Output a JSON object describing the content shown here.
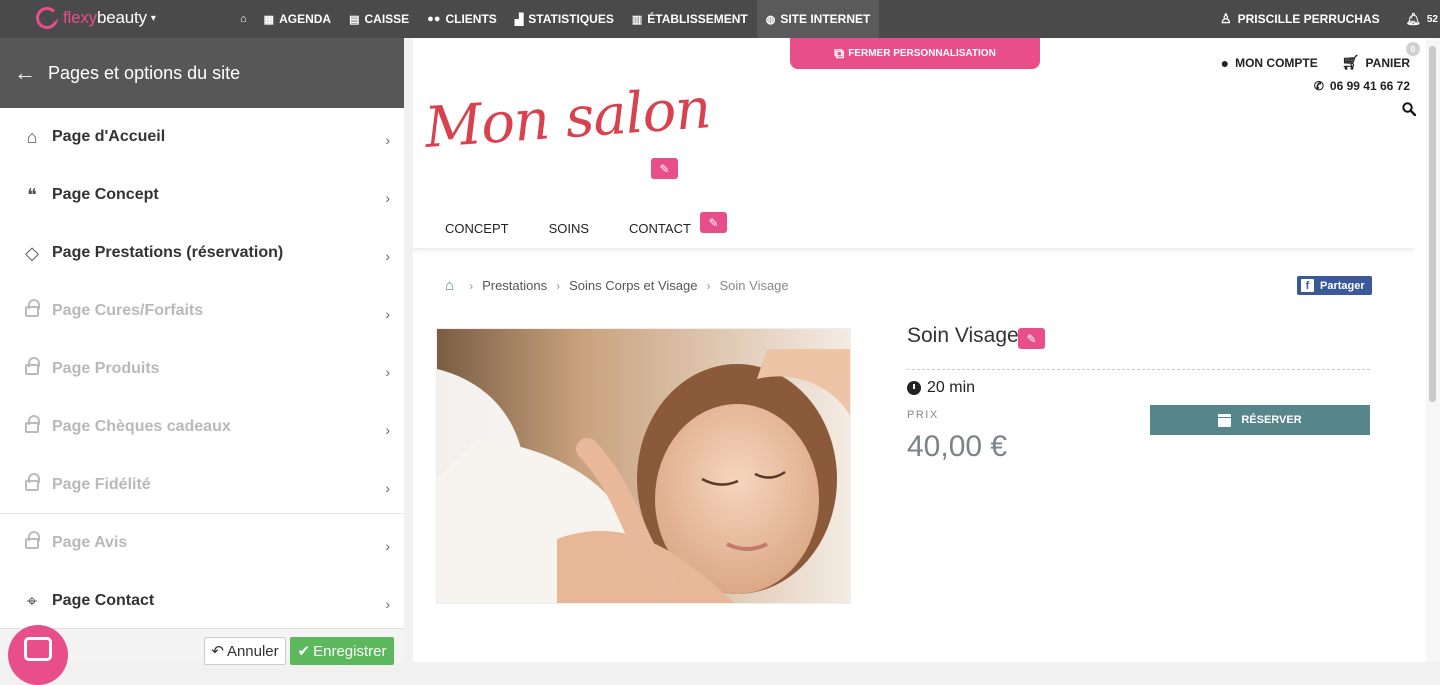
{
  "topbar": {
    "brand_flexy": "flexy",
    "brand_beauty": "beauty",
    "nav": [
      {
        "label": "",
        "icon": "home-icon"
      },
      {
        "label": "AGENDA",
        "icon": "calendar-icon"
      },
      {
        "label": "CAISSE",
        "icon": "money-icon"
      },
      {
        "label": "CLIENTS",
        "icon": "users-icon"
      },
      {
        "label": "STATISTIQUES",
        "icon": "chart-icon"
      },
      {
        "label": "ÉTABLISSEMENT",
        "icon": "store-icon"
      },
      {
        "label": "SITE INTERNET",
        "icon": "globe-icon"
      }
    ],
    "user_name": "PRISCILLE PERRUCHAS",
    "notif_count": "52"
  },
  "panel": {
    "title": "Pages et options du site",
    "items": [
      {
        "label": "Page d'Accueil",
        "icon": "home-outline-icon",
        "locked": false
      },
      {
        "label": "Page Concept",
        "icon": "quote-icon",
        "locked": false
      },
      {
        "label": "Page Prestations (réservation)",
        "icon": "tag-icon",
        "locked": false
      },
      {
        "label": "Page Cures/Forfaits",
        "icon": "lock-icon",
        "locked": true
      },
      {
        "label": "Page Produits",
        "icon": "lock-icon",
        "locked": true
      },
      {
        "label": "Page Chèques cadeaux",
        "icon": "lock-icon",
        "locked": true
      },
      {
        "label": "Page Fidélité",
        "icon": "lock-icon",
        "locked": true
      },
      {
        "label": "Page Avis",
        "icon": "lock-icon",
        "locked": true
      },
      {
        "label": "Page Contact",
        "icon": "map-pin-icon",
        "locked": false
      }
    ],
    "cancel_label": "Annuler",
    "save_label": "Enregistrer"
  },
  "preview": {
    "fermer_label": "FERMER PERSONNALISATION",
    "account_label": "MON COMPTE",
    "cart_label": "PANIER",
    "cart_count": "0",
    "phone": "06 99 41 66 72",
    "brand": "Mon salon",
    "site_nav": [
      "CONCEPT",
      "SOINS",
      "CONTACT"
    ],
    "breadcrumb": [
      "Prestations",
      "Soins Corps et Visage",
      "Soin Visage"
    ],
    "share_label": "Partager",
    "product_title": "Soin Visage",
    "duration": "20 min",
    "prix_label": "PRIX",
    "price": "40,00 €",
    "reserve_label": "RÉSERVER"
  },
  "colors": {
    "accent_pink": "#e84e8a",
    "topbar": "#4a4a4a",
    "reserve_teal": "#56858a",
    "save_green": "#5cb85c",
    "brand_red": "#d8424f"
  }
}
